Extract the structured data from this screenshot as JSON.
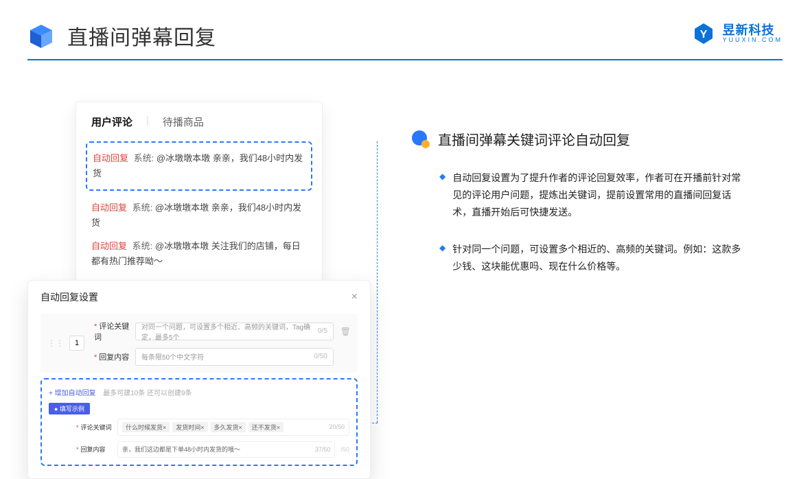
{
  "header": {
    "title": "直播间弹幕回复",
    "brand_name": "昱新科技",
    "brand_sub": "YUUXIN.COM"
  },
  "comments": {
    "tab_active": "用户评论",
    "tab_inactive": "待播商品",
    "rows": [
      {
        "tag": "自动回复",
        "sys": "系统:",
        "text": "@冰墩墩本墩 亲亲，我们48小时内发货"
      },
      {
        "tag": "自动回复",
        "sys": "系统:",
        "text": "@冰墩墩本墩 亲亲，我们48小时内发货"
      },
      {
        "tag": "自动回复",
        "sys": "系统:",
        "text": "@冰墩墩本墩 关注我们的店铺，每日都有热门推荐呦～"
      }
    ]
  },
  "settings": {
    "title": "自动回复设置",
    "row_num": "1",
    "label_keyword": "评论关键词",
    "placeholder_keyword": "对同一个问题，可设置多个相近、高频的关键词，Tag确定，最多5个",
    "counter_keyword": "0/5",
    "label_reply": "回复内容",
    "placeholder_reply": "每条限50个中文字符",
    "counter_reply": "0/50",
    "add_text": "+ 增加自动回复",
    "add_hint": "最多可建10条 还可以创建9条",
    "example_badge": "● 填写示例",
    "ex_label_kw": "评论关键词",
    "ex_tags": [
      "什么时候发货×",
      "发货时间×",
      "多久发货×",
      "还不发货×"
    ],
    "ex_kw_counter": "20/50",
    "ex_label_reply": "回复内容",
    "ex_reply_text": "亲，我们这边都是下单48小时内发货的哦～",
    "ex_reply_counter": "37/50",
    "outer_counter": "/50"
  },
  "right": {
    "section_title": "直播间弹幕关键词评论自动回复",
    "bullets": [
      "自动回复设置为了提升作者的评论回复效率，作者可在开播前针对常见的评论用户问题，提炼出关键词，提前设置常用的直播间回复话术，直播开始后可快捷发送。",
      "针对同一个问题，可设置多个相近的、高频的关键词。例如：这款多少钱、这块能优惠吗、现在什么价格等。"
    ]
  }
}
